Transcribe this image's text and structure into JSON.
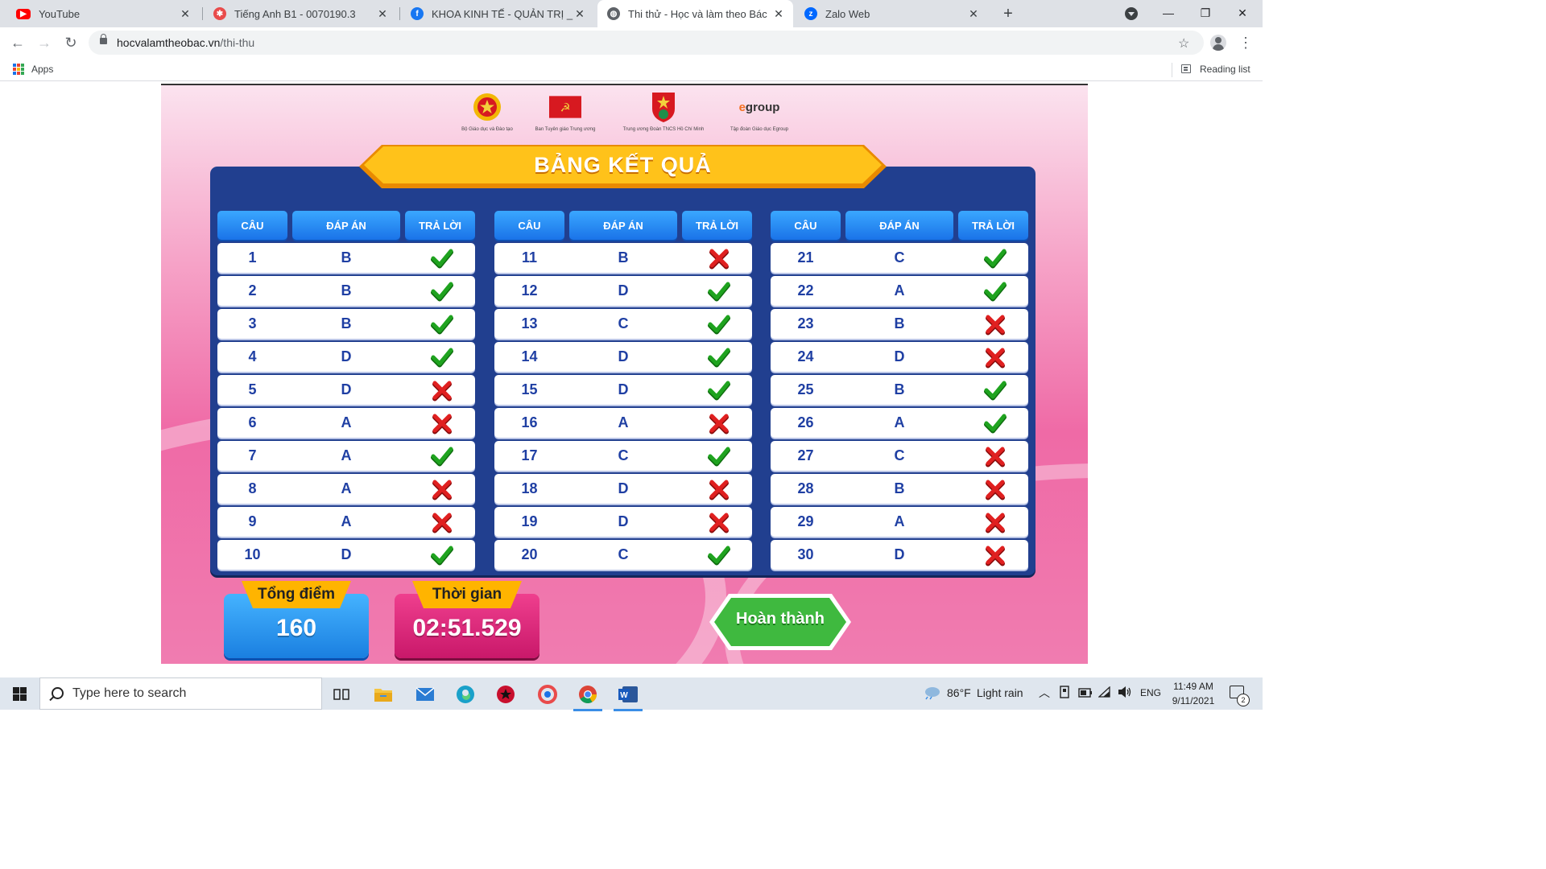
{
  "browser": {
    "tabs": [
      {
        "title": "YouTube",
        "icon": "youtube-icon",
        "active": false
      },
      {
        "title": "Tiếng Anh B1 - 0070190.3",
        "icon": "moodle-icon",
        "active": false
      },
      {
        "title": "KHOA KINH TẾ - QUẢN TRỊ _DNT",
        "icon": "facebook-icon",
        "active": false
      },
      {
        "title": "Thi thử - Học và làm theo Bác",
        "icon": "globe-icon",
        "active": true
      },
      {
        "title": "Zalo Web",
        "icon": "zalo-icon",
        "active": false
      }
    ],
    "url_host": "hocvalamtheobac.vn",
    "url_path": "/thi-thu",
    "bookmarks_apps": "Apps",
    "reading_list": "Reading list"
  },
  "logos": [
    {
      "caption": "Bộ Giáo dục và Đào tạo",
      "icon": "emblem-icon"
    },
    {
      "caption": "Ban Tuyên giáo Trung ương",
      "icon": "party-flag-icon"
    },
    {
      "caption": "Trung ương Đoàn TNCS Hồ Chí Minh",
      "icon": "youth-union-icon"
    },
    {
      "caption": "Tập đoàn Giáo dục Egroup",
      "icon": "egroup-logo",
      "wordmark_e": "e",
      "wordmark_rest": "group"
    }
  ],
  "results": {
    "title": "BẢNG KẾT QUẢ",
    "headers": {
      "question": "CÂU",
      "answer": "ĐÁP ÁN",
      "result": "TRẢ LỜI"
    },
    "columns": [
      [
        {
          "q": "1",
          "a": "B",
          "correct": true
        },
        {
          "q": "2",
          "a": "B",
          "correct": true
        },
        {
          "q": "3",
          "a": "B",
          "correct": true
        },
        {
          "q": "4",
          "a": "D",
          "correct": true
        },
        {
          "q": "5",
          "a": "D",
          "correct": false
        },
        {
          "q": "6",
          "a": "A",
          "correct": false
        },
        {
          "q": "7",
          "a": "A",
          "correct": true
        },
        {
          "q": "8",
          "a": "A",
          "correct": false
        },
        {
          "q": "9",
          "a": "A",
          "correct": false
        },
        {
          "q": "10",
          "a": "D",
          "correct": true
        }
      ],
      [
        {
          "q": "11",
          "a": "B",
          "correct": false
        },
        {
          "q": "12",
          "a": "D",
          "correct": true
        },
        {
          "q": "13",
          "a": "C",
          "correct": true
        },
        {
          "q": "14",
          "a": "D",
          "correct": true
        },
        {
          "q": "15",
          "a": "D",
          "correct": true
        },
        {
          "q": "16",
          "a": "A",
          "correct": false
        },
        {
          "q": "17",
          "a": "C",
          "correct": true
        },
        {
          "q": "18",
          "a": "D",
          "correct": false
        },
        {
          "q": "19",
          "a": "D",
          "correct": false
        },
        {
          "q": "20",
          "a": "C",
          "correct": true
        }
      ],
      [
        {
          "q": "21",
          "a": "C",
          "correct": true
        },
        {
          "q": "22",
          "a": "A",
          "correct": true
        },
        {
          "q": "23",
          "a": "B",
          "correct": false
        },
        {
          "q": "24",
          "a": "D",
          "correct": false
        },
        {
          "q": "25",
          "a": "B",
          "correct": true
        },
        {
          "q": "26",
          "a": "A",
          "correct": true
        },
        {
          "q": "27",
          "a": "C",
          "correct": false
        },
        {
          "q": "28",
          "a": "B",
          "correct": false
        },
        {
          "q": "29",
          "a": "A",
          "correct": false
        },
        {
          "q": "30",
          "a": "D",
          "correct": false
        }
      ]
    ],
    "score_label": "Tổng điểm",
    "score": "160",
    "time_label": "Thời gian",
    "time": "02:51.529",
    "finish_label": "Hoàn thành"
  },
  "colors": {
    "panel": "#213f8f",
    "header": "#1a73e8",
    "banner": "#ffb400",
    "correct": "#1fa31f",
    "wrong": "#e02020",
    "finish": "#3fb93f"
  },
  "taskbar": {
    "search_placeholder": "Type here to search",
    "weather_temp": "86°F",
    "weather_text": "Light rain",
    "language": "ENG",
    "time": "11:49 AM",
    "date": "9/11/2021",
    "notification_count": "2"
  }
}
